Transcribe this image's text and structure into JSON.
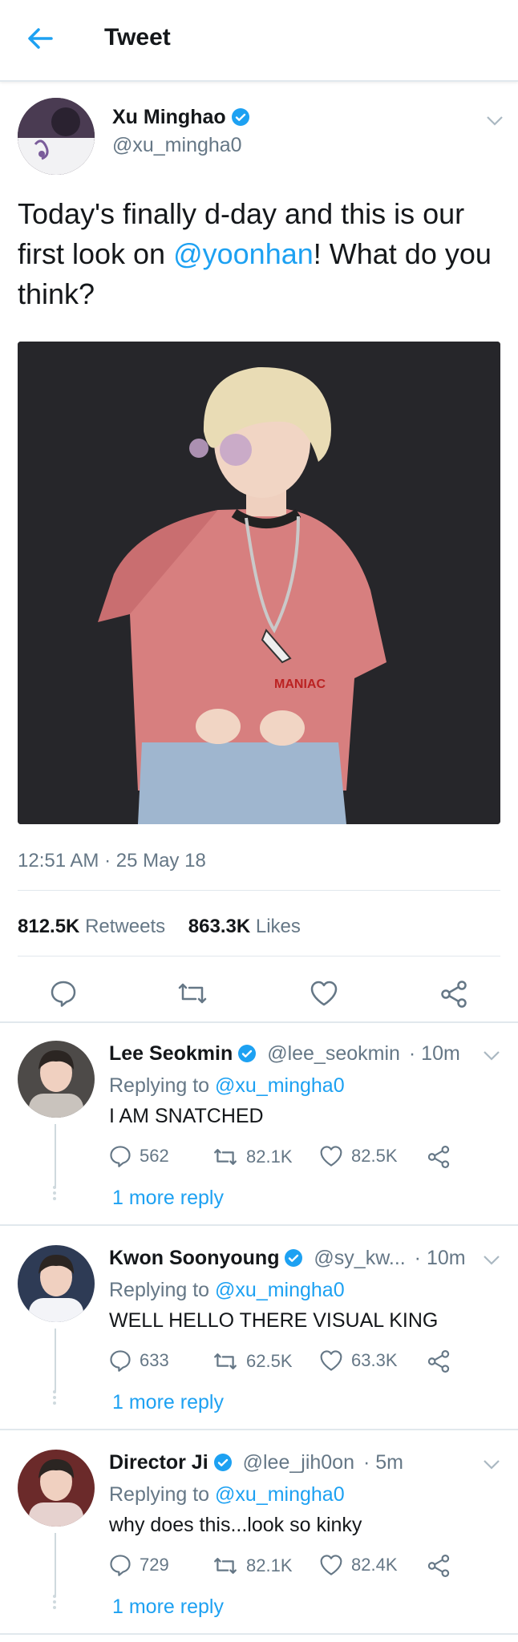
{
  "header": {
    "title": "Tweet"
  },
  "tweet": {
    "author_name": "Xu Minghao",
    "author_handle": "@xu_mingha0",
    "text_before": "Today's finally d-day and this is our first look on ",
    "mention": "@yoonhan",
    "text_after": "! What do you think?",
    "image_text": "MANIAC",
    "timestamp": "12:51 AM · 25 May 18",
    "retweets_count": "812.5K",
    "retweets_label": "Retweets",
    "likes_count": "863.3K",
    "likes_label": "Likes"
  },
  "colors": {
    "accent": "#1da1f2",
    "muted": "#657786",
    "border": "#e1e8ed"
  },
  "replies": [
    {
      "name": "Lee Seokmin",
      "handle": "@lee_seokmin",
      "time": "· 10m",
      "replying_prefix": "Replying to",
      "replying_to": "@xu_mingha0",
      "text": "I AM SNATCHED",
      "replies": "562",
      "retweets": "82.1K",
      "likes": "82.5K",
      "more": "1 more reply"
    },
    {
      "name": "Kwon Soonyoung",
      "handle": "@sy_kw...",
      "time": "· 10m",
      "replying_prefix": "Replying to",
      "replying_to": "@xu_mingha0",
      "text": "WELL HELLO THERE VISUAL KING",
      "replies": "633",
      "retweets": "62.5K",
      "likes": "63.3K",
      "more": "1 more reply"
    },
    {
      "name": "Director Ji",
      "handle": "@lee_jih0on",
      "time": "· 5m",
      "replying_prefix": "Replying to",
      "replying_to": "@xu_mingha0",
      "text": "why does this...look so kinky",
      "replies": "729",
      "retweets": "82.1K",
      "likes": "82.4K",
      "more": "1 more reply"
    }
  ]
}
